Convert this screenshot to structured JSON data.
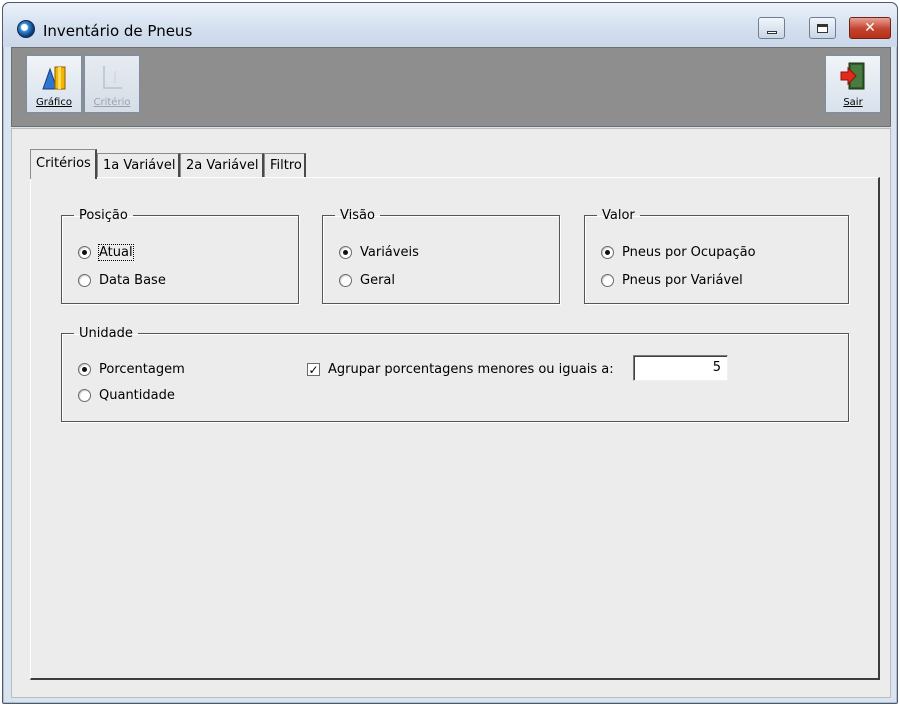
{
  "window": {
    "title": "Inventário de Pneus",
    "controls": {
      "minimize": "minimize-icon",
      "maximize": "restore-icon",
      "close": "✕"
    }
  },
  "toolbar": {
    "grafico_label": "Gráfico",
    "criterio_label": "Critério",
    "sair_label": "Sair"
  },
  "tabs": [
    {
      "label": "Critérios",
      "active": true
    },
    {
      "label": "1a Variável"
    },
    {
      "label": "2a Variável"
    },
    {
      "label": "Filtro"
    }
  ],
  "posicao": {
    "legend": "Posição",
    "options": [
      {
        "label": "Atual",
        "selected": true
      },
      {
        "label": "Data Base",
        "selected": false
      }
    ]
  },
  "visao": {
    "legend": "Visão",
    "options": [
      {
        "label": "Variáveis",
        "selected": true
      },
      {
        "label": "Geral",
        "selected": false
      }
    ]
  },
  "valor": {
    "legend": "Valor",
    "options": [
      {
        "label": "Pneus por Ocupação",
        "selected": true
      },
      {
        "label": "Pneus por Variável",
        "selected": false
      }
    ]
  },
  "unidade": {
    "legend": "Unidade",
    "options": [
      {
        "label": "Porcentagem",
        "selected": true
      },
      {
        "label": "Quantidade",
        "selected": false
      }
    ],
    "agrupar": {
      "label": "Agrupar porcentagens menores ou iguais a:",
      "checked": true,
      "value": "5"
    }
  },
  "colors": {
    "toolbar_bg": "#8e8e8e",
    "panel_bg": "#ececec",
    "close_red": "#c2432d"
  }
}
